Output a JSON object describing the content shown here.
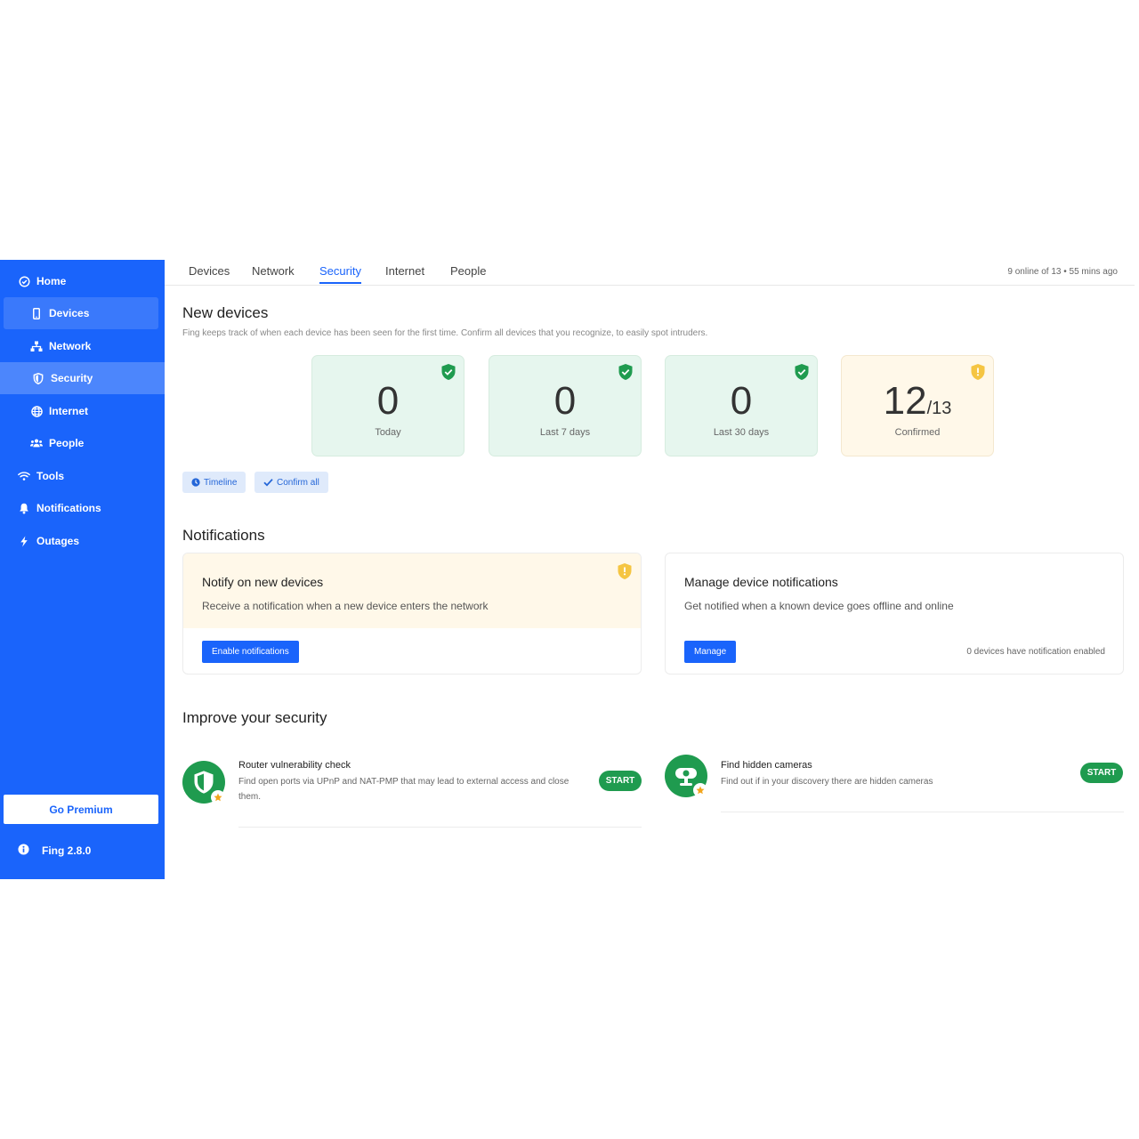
{
  "sidebar": {
    "home": "Home",
    "items": [
      {
        "label": "Devices"
      },
      {
        "label": "Network"
      },
      {
        "label": "Security"
      },
      {
        "label": "Internet"
      },
      {
        "label": "People"
      }
    ],
    "tools": "Tools",
    "notifications": "Notifications",
    "outages": "Outages",
    "premium": "Go Premium",
    "version": "Fing 2.8.0"
  },
  "tabs": [
    {
      "label": "Devices"
    },
    {
      "label": "Network"
    },
    {
      "label": "Security"
    },
    {
      "label": "Internet"
    },
    {
      "label": "People"
    }
  ],
  "active_tab": "Security",
  "status": "9 online of 13 • 55 mins ago",
  "new_devices": {
    "title": "New devices",
    "description": "Fing keeps track of when each device has been seen for the first time. Confirm all devices that you recognize, to easily spot intruders.",
    "stats": [
      {
        "value": "0",
        "label": "Today"
      },
      {
        "value": "0",
        "label": "Last 7 days"
      },
      {
        "value": "0",
        "label": "Last 30 days"
      },
      {
        "value": "12",
        "denominator": "/13",
        "label": "Confirmed"
      }
    ],
    "timeline_label": "Timeline",
    "confirm_label": "Confirm all"
  },
  "notifications": {
    "title": "Notifications",
    "new_devices": {
      "title": "Notify on new devices",
      "description": "Receive a notification when a new device enters the network",
      "button": "Enable notifications"
    },
    "manage": {
      "title": "Manage device notifications",
      "description": "Get notified when a known device goes offline and online",
      "button": "Manage",
      "note": "0 devices have notification enabled"
    }
  },
  "improve": {
    "title": "Improve your security",
    "items": [
      {
        "title": "Router vulnerability check",
        "description": "Find open ports via UPnP and NAT-PMP that may lead to external access and close them.",
        "button": "START"
      },
      {
        "title": "Find hidden cameras",
        "description": "Find out if in your discovery there are hidden cameras",
        "button": "START"
      }
    ]
  },
  "colors": {
    "brand": "#1a64fb",
    "success": "#1f9b4f",
    "warning": "#f5c542"
  }
}
